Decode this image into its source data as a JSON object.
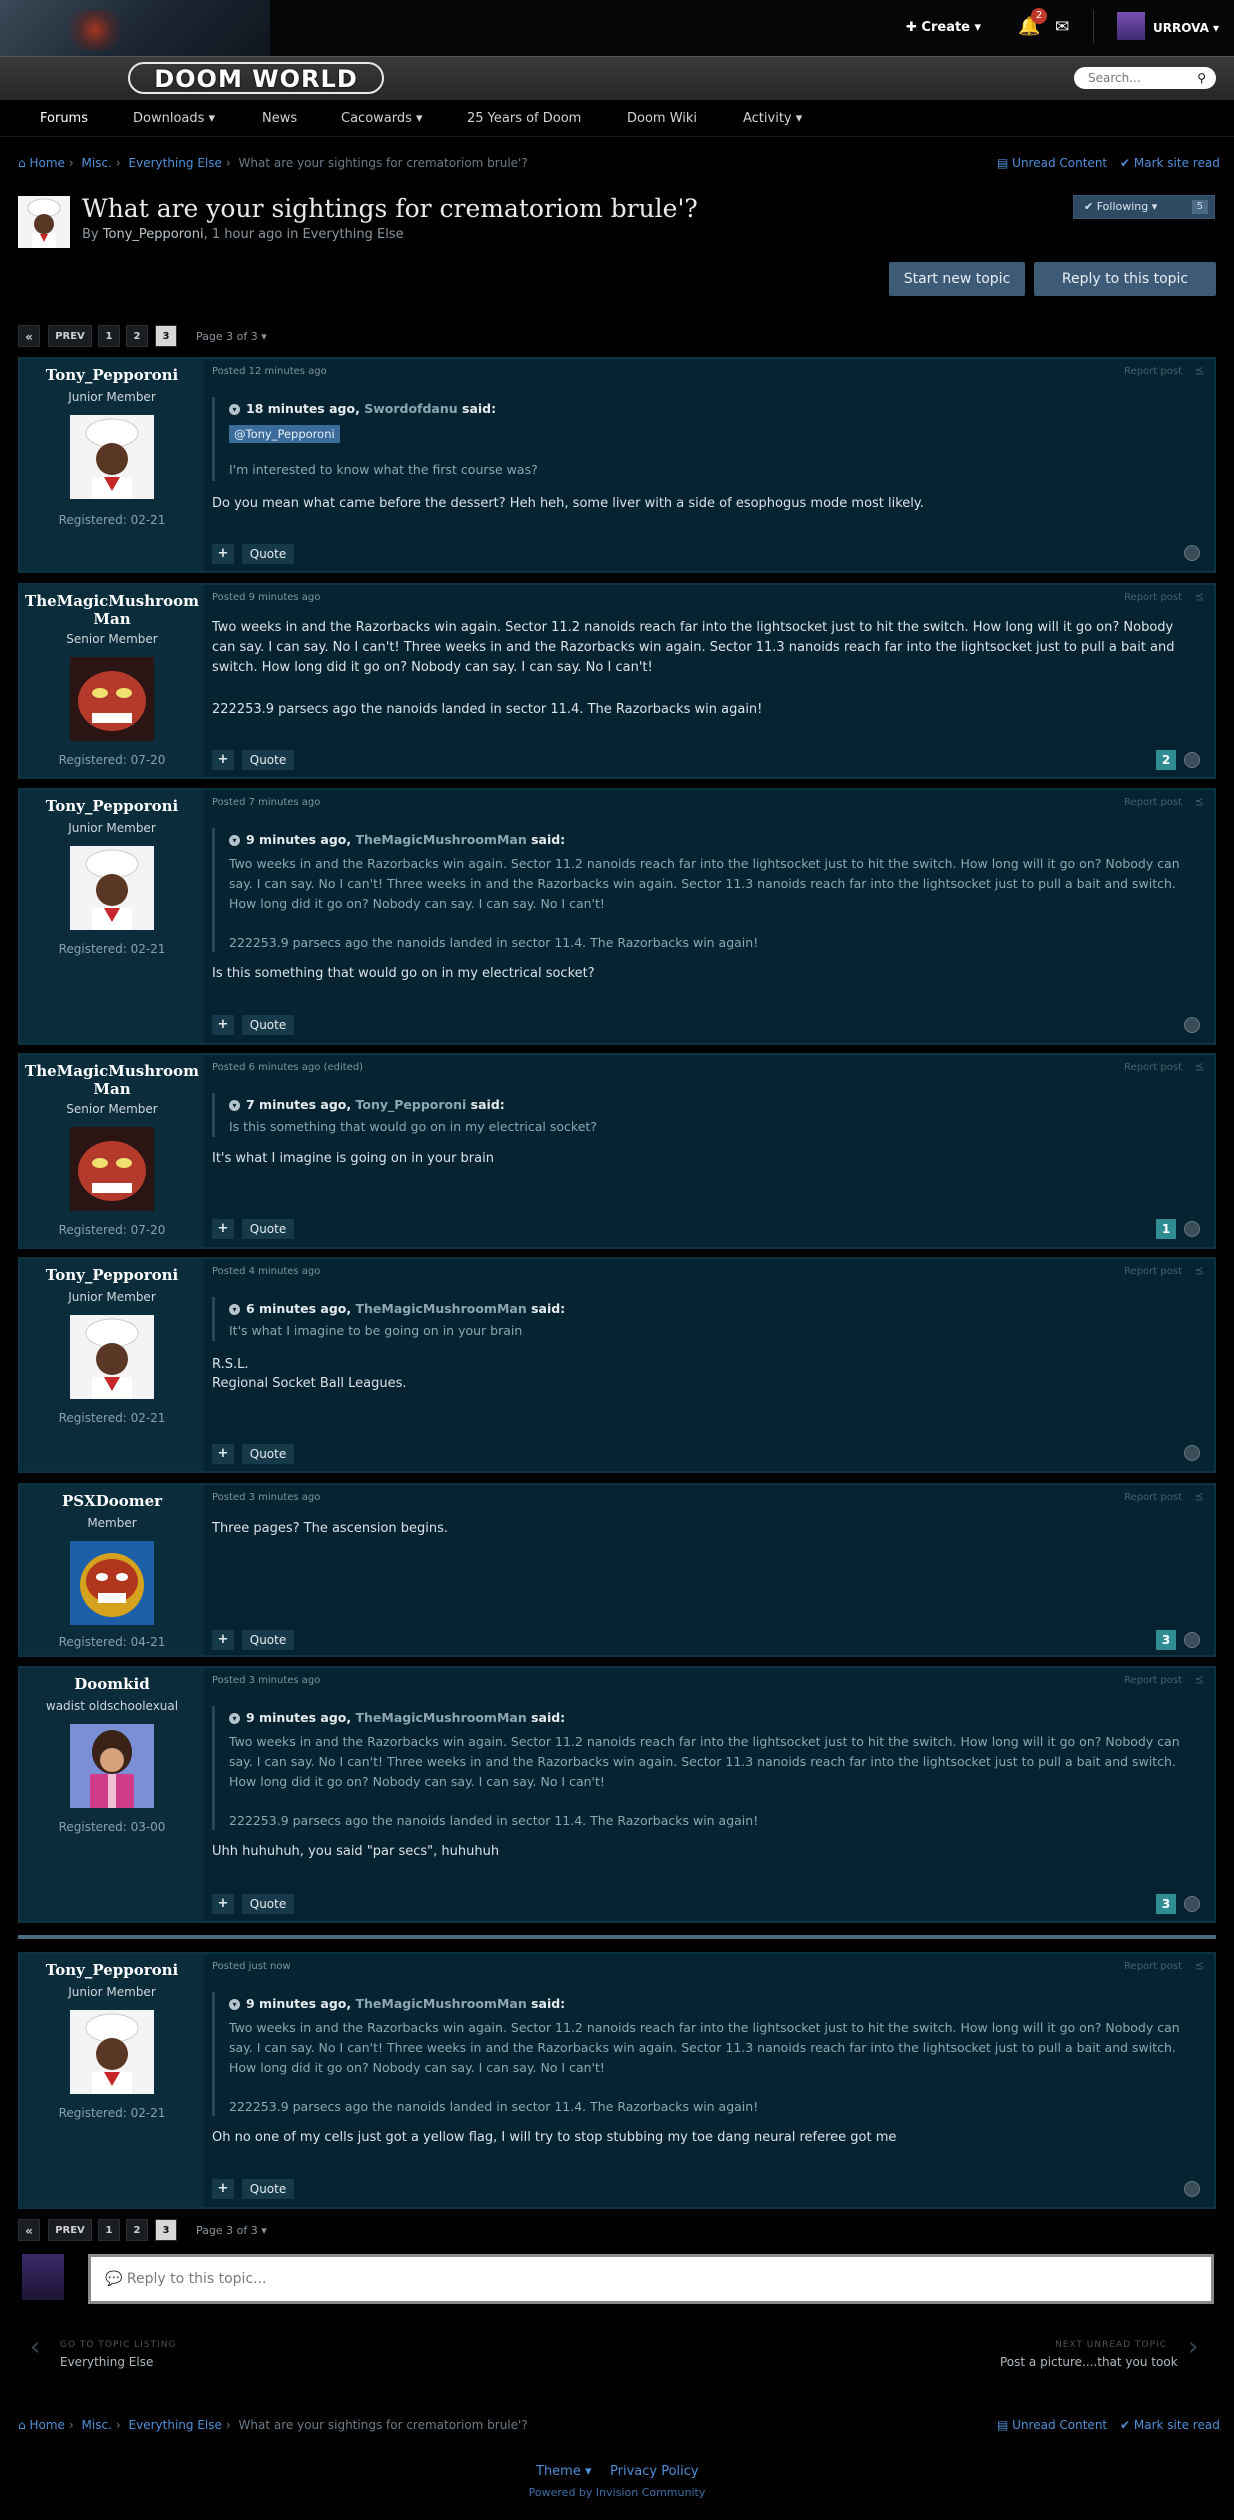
{
  "header": {
    "logo_text": "DOOM WORLD",
    "search_placeholder": "Search...",
    "create_label": "Create",
    "notif_count": "2",
    "username": "URROVA"
  },
  "nav": {
    "items": [
      "Forums",
      "Downloads",
      "News",
      "Cacowards",
      "25 Years of Doom",
      "Doom Wiki",
      "Activity"
    ]
  },
  "breadcrumb": {
    "home": "Home",
    "misc": "Misc.",
    "everything_else": "Everything Else",
    "current": "What are your sightings for crematoriom brule'?",
    "unread": "Unread Content",
    "mark_read": "Mark site read"
  },
  "topic": {
    "title": "What are your sightings for crematoriom brule'?",
    "by": "By",
    "author": "Tony_Pepporoni",
    "time": ", 1 hour ago in Everything Else",
    "following": "Following",
    "follow_count": "5",
    "start_new": "Start new topic",
    "reply": "Reply to this topic"
  },
  "pagination": {
    "prev": "PREV",
    "pages": [
      "1",
      "2",
      "3"
    ],
    "label": "Page 3 of 3"
  },
  "common": {
    "report": "Report post",
    "quote": "Quote",
    "said": "said:"
  },
  "posts": [
    {
      "name": "Tony_Pepporoni",
      "rank": "Junior Member",
      "reg": "Registered: 02-21",
      "meta": "Posted 12 minutes ago",
      "q_time": "18 minutes ago,",
      "q_who": "Swordofdanu",
      "q_mention": "@Tony_Pepporoni",
      "q_text": "I'm interested to know what the first course was?",
      "body": "Do you mean what came before the dessert? Heh heh, some liver with a side of esophogus mode most likely."
    },
    {
      "name_l1": "TheMagicMushroom",
      "name_l2": "Man",
      "rank": "Senior Member",
      "reg": "Registered: 07-20",
      "meta": "Posted 9 minutes ago",
      "body1": "Two weeks in and the Razorbacks win again. Sector 11.2 nanoids reach far into the lightsocket just to hit the switch. How long will it go on? Nobody can say. I can say. No I can't! Three weeks in and the Razorbacks win again. Sector 11.3 nanoids reach far into the lightsocket just to pull a bait and switch. How long did it go on? Nobody can say. I can say. No I can't!",
      "body2": "222253.9 parsecs ago the nanoids landed in sector 11.4. The Razorbacks win again!",
      "rep": "2"
    },
    {
      "name": "Tony_Pepporoni",
      "rank": "Junior Member",
      "reg": "Registered: 02-21",
      "meta": "Posted 7 minutes ago",
      "q_time": "9 minutes ago,",
      "q_who": "TheMagicMushroomMan",
      "q_text1": "Two weeks in and the Razorbacks win again. Sector 11.2 nanoids reach far into the lightsocket just to hit the switch. How long will it go on? Nobody can say. I can say. No I can't! Three weeks in and the Razorbacks win again. Sector 11.3 nanoids reach far into the lightsocket just to pull a bait and switch. How long did it go on? Nobody can say. I can say. No I can't!",
      "q_text2": "222253.9 parsecs ago the nanoids landed in sector 11.4. The Razorbacks win again!",
      "body": "Is this something that would go on in my electrical socket?"
    },
    {
      "name_l1": "TheMagicMushroom",
      "name_l2": "Man",
      "rank": "Senior Member",
      "reg": "Registered: 07-20",
      "meta": "Posted 6 minutes ago (edited)",
      "q_time": "7 minutes ago,",
      "q_who": "Tony_Pepporoni",
      "q_text": "Is this something that would go on in my electrical socket?",
      "body": "It's what I imagine is going on in your brain",
      "rep": "1"
    },
    {
      "name": "Tony_Pepporoni",
      "rank": "Junior Member",
      "reg": "Registered: 02-21",
      "meta": "Posted 4 minutes ago",
      "q_time": "6 minutes ago,",
      "q_who": "TheMagicMushroomMan",
      "q_text": "It's what I imagine to be going on in your brain",
      "body1": "R.S.L.",
      "body2": "Regional Socket Ball Leagues."
    },
    {
      "name": "PSXDoomer",
      "rank": "Member",
      "reg": "Registered: 04-21",
      "meta": "Posted 3 minutes ago",
      "body": "Three pages? The ascension begins.",
      "rep": "3"
    },
    {
      "name": "Doomkid",
      "rank": "wadist oldschoolexual",
      "reg": "Registered: 03-00",
      "meta": "Posted 3 minutes ago",
      "q_time": "9 minutes ago,",
      "q_who": "TheMagicMushroomMan",
      "q_text1": "Two weeks in and the Razorbacks win again. Sector 11.2 nanoids reach far into the lightsocket just to hit the switch. How long will it go on? Nobody can say. I can say. No I can't! Three weeks in and the Razorbacks win again. Sector 11.3 nanoids reach far into the lightsocket just to pull a bait and switch. How long did it go on? Nobody can say. I can say. No I can't!",
      "q_text2": "222253.9 parsecs ago the nanoids landed in sector 11.4. The Razorbacks win again!",
      "body": "Uhh huhuhuh, you said \"par secs\", huhuhuh",
      "rep": "3"
    },
    {
      "name": "Tony_Pepporoni",
      "rank": "Junior Member",
      "reg": "Registered: 02-21",
      "meta": "Posted just now",
      "q_time": "9 minutes ago,",
      "q_who": "TheMagicMushroomMan",
      "q_text1": "Two weeks in and the Razorbacks win again. Sector 11.2 nanoids reach far into the lightsocket just to hit the switch. How long will it go on? Nobody can say. I can say. No I can't! Three weeks in and the Razorbacks win again. Sector 11.3 nanoids reach far into the lightsocket just to pull a bait and switch. How long did it go on? Nobody can say. I can say. No I can't!",
      "q_text2": "222253.9 parsecs ago the nanoids landed in sector 11.4. The Razorbacks win again!",
      "body": "Oh no one of my cells just got a yellow flag, I will try to stop stubbing my toe dang neural referee got me"
    }
  ],
  "reply_box": {
    "placeholder": "Reply to this topic..."
  },
  "bottom_nav": {
    "prev_label": "GO TO TOPIC LISTING",
    "prev_value": "Everything Else",
    "next_label": "NEXT UNREAD TOPIC",
    "next_value": "Post a picture....that you took"
  },
  "footer": {
    "theme": "Theme",
    "privacy": "Privacy Policy",
    "powered": "Powered by Invision Community"
  }
}
